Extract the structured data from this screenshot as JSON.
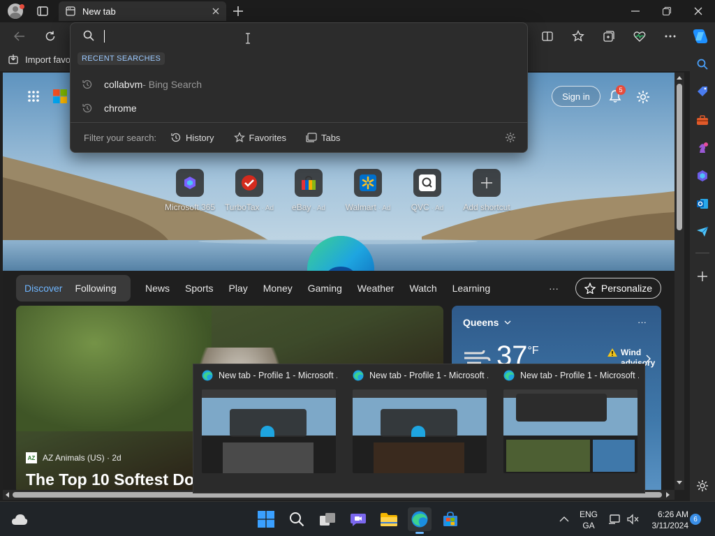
{
  "window": {
    "tab_title": "New tab"
  },
  "favorites_bar": {
    "import_label": "Import favo"
  },
  "dropdown": {
    "section_label": "RECENT SEARCHES",
    "items": [
      {
        "query": "collabvm",
        "suffix": " - Bing Search"
      },
      {
        "query": "chrome",
        "suffix": ""
      }
    ],
    "filter_label": "Filter your search:",
    "filters": [
      "History",
      "Favorites",
      "Tabs"
    ]
  },
  "newtab": {
    "sign_in": "Sign in",
    "notification_count": "5",
    "shortcuts": [
      {
        "label": "Microsoft 365",
        "ad": ""
      },
      {
        "label": "TurboTax",
        "ad": " · Ad"
      },
      {
        "label": "eBay",
        "ad": " · Ad"
      },
      {
        "label": "Walmart",
        "ad": " · Ad"
      },
      {
        "label": "QVC",
        "ad": " · Ad"
      },
      {
        "label": "Add shortcut",
        "ad": ""
      }
    ],
    "feed_tabs": {
      "discover": "Discover",
      "following": "Following"
    },
    "nav": [
      "News",
      "Sports",
      "Play",
      "Money",
      "Gaming",
      "Weather",
      "Watch",
      "Learning"
    ],
    "more": "···",
    "personalize": "Personalize",
    "article": {
      "source": "AZ Animals (US) · 2d",
      "headline": "The Top 10 Softest Do"
    },
    "weather": {
      "location": "Queens",
      "temp": "37",
      "unit": "°F",
      "alert": "Wind",
      "alert_line2": "advisory"
    }
  },
  "taskbar_previews": [
    {
      "title": "New tab - Profile 1 - Microsoft ..."
    },
    {
      "title": "New tab - Profile 1 - Microsoft ..."
    },
    {
      "title": "New tab - Profile 1 - Microsoft ..."
    }
  ],
  "taskbar": {
    "lang_line1": "ENG",
    "lang_line2": "GA",
    "time": "6:26 AM",
    "date": "3/11/2024",
    "badge": "6"
  },
  "colors": {
    "accent": "#0078d4",
    "notification": "#e74c3c",
    "tab_bg": "#2f2f2f"
  }
}
